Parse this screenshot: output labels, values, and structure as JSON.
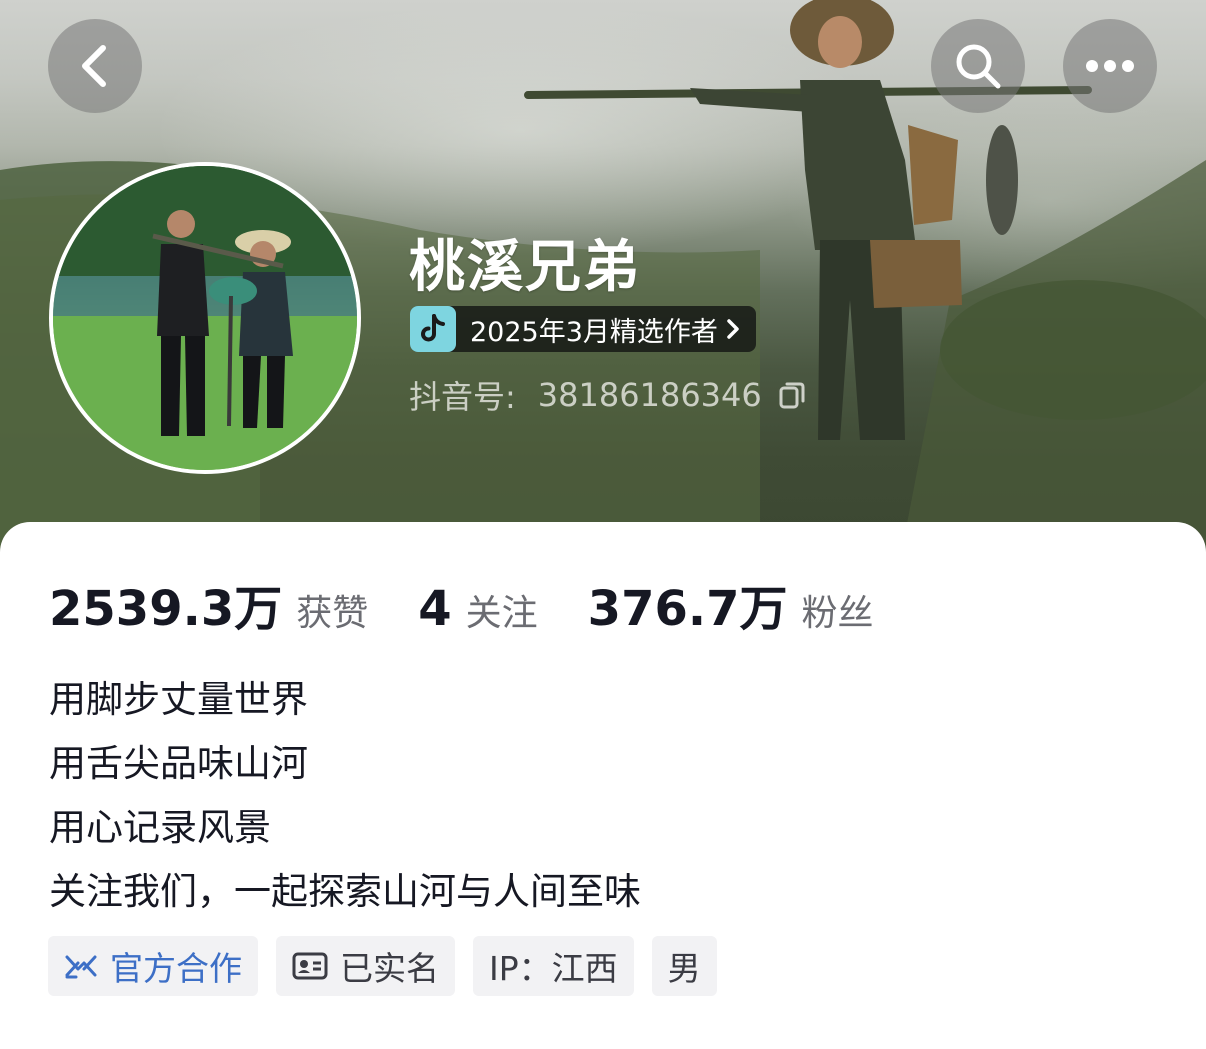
{
  "header": {
    "back_icon": "chevron-left-icon",
    "search_icon": "search-icon",
    "more_icon": "more-horizontal-icon"
  },
  "profile": {
    "name": "桃溪兄弟",
    "creator_badge": "2025年3月精选作者",
    "douyin_id_label": "抖音号:",
    "douyin_id": "38186186346"
  },
  "stats": [
    {
      "value": "2539.3万",
      "label": "获赞"
    },
    {
      "value": "4",
      "label": "关注"
    },
    {
      "value": "376.7万",
      "label": "粉丝"
    }
  ],
  "bio": [
    "用脚步丈量世界",
    "用舌尖品味山河",
    "用心记录风景",
    "关注我们，一起探索山河与人间至味"
  ],
  "tags": [
    {
      "label": "官方合作",
      "icon": "cooperation-icon"
    },
    {
      "label": "已实名",
      "icon": "id-card-icon"
    },
    {
      "label": "IP：江西"
    },
    {
      "label": "男"
    }
  ],
  "colors": {
    "official_tag": "#3d6fc6",
    "badge_logo": "#7ed5e0",
    "text_primary": "#161823"
  }
}
